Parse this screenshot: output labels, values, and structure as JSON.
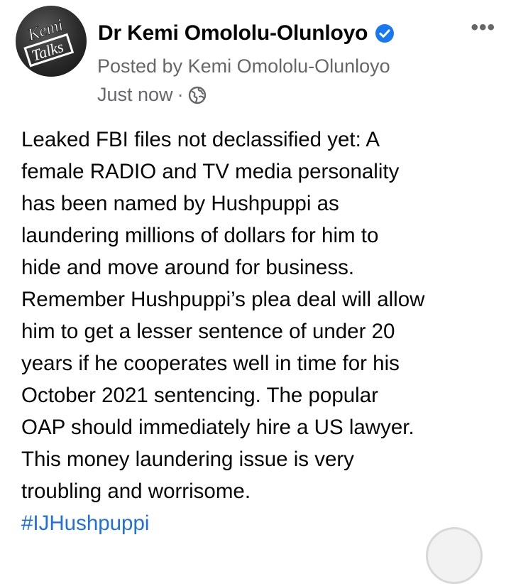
{
  "author": {
    "name": "Dr Kemi Omololu-Olunloyo",
    "verified": true,
    "avatar_text_top": "Kemi",
    "avatar_text_bottom": "Talks"
  },
  "post_meta": {
    "posted_by": "Posted by Kemi Omololu-Olunloyo",
    "time": "Just now",
    "separator": "·",
    "audience_icon": "globe-icon"
  },
  "menu": {
    "more_label": "•••"
  },
  "post": {
    "lines": [
      "Leaked FBI files not declassified yet: A",
      "female RADIO and TV media personality",
      "has been named by Hushpuppi as",
      "laundering millions of dollars for him to",
      "hide and move around for business.",
      "Remember Hushpuppi’s plea deal will allow",
      "him to get a lesser sentence of under 20",
      "years if he cooperates well in time for his",
      "October 2021 sentencing. The popular",
      "OAP should immediately hire a US lawyer.",
      "This money laundering issue is very",
      "troubling and worrisome."
    ],
    "hashtag": "#IJHushpuppi"
  },
  "colors": {
    "name_text": "#050505",
    "secondary_text": "#65676b",
    "hashtag": "#216fdb",
    "verified_badge": "#1877f2"
  }
}
